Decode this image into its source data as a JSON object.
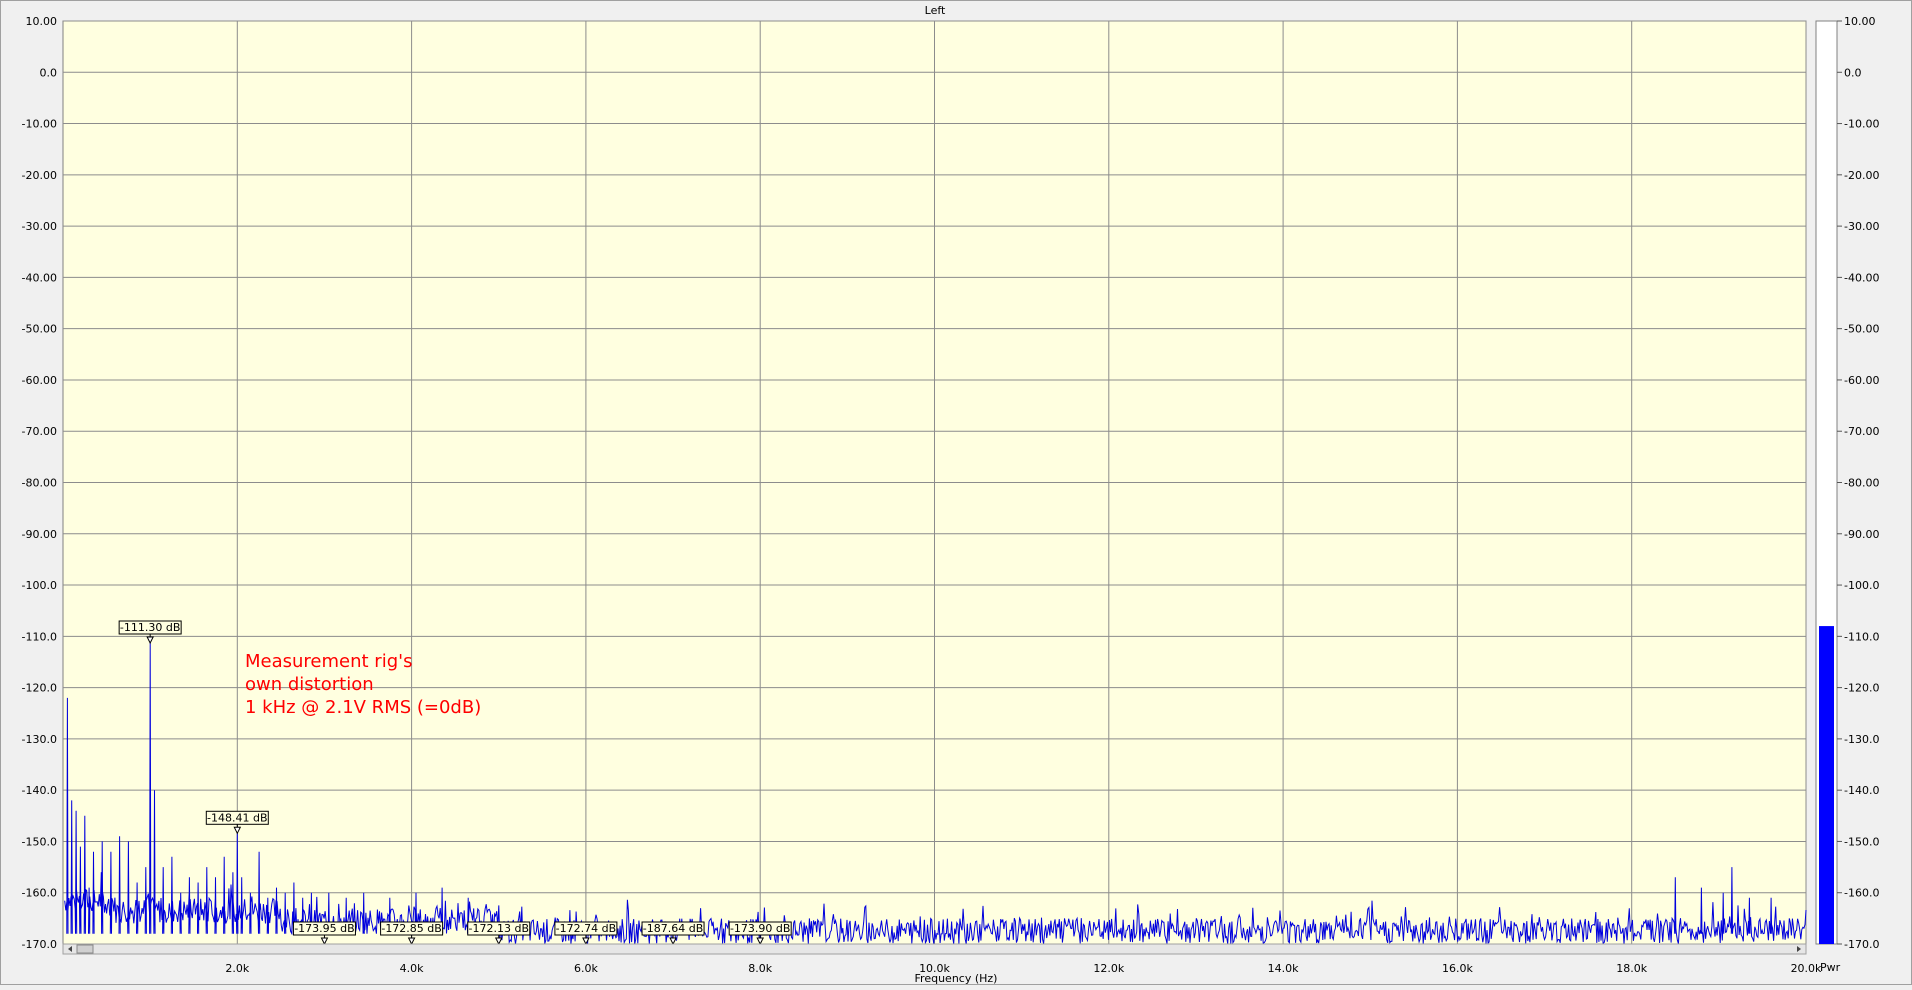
{
  "chart_data": {
    "type": "line",
    "title": "Left",
    "xlabel": "Frequency (Hz)",
    "ylabel": "",
    "xlim": [
      0,
      20000
    ],
    "ylim": [
      -170,
      10
    ],
    "grid": true,
    "y_ticks": [
      "10.00",
      "0.0",
      "-10.00",
      "-20.00",
      "-30.00",
      "-40.00",
      "-50.00",
      "-60.00",
      "-70.00",
      "-80.00",
      "-90.00",
      "-100.0",
      "-110.0",
      "-120.0",
      "-130.0",
      "-140.0",
      "-150.0",
      "-160.0",
      "-170.0"
    ],
    "y_tick_values": [
      10,
      0,
      -10,
      -20,
      -30,
      -40,
      -50,
      -60,
      -70,
      -80,
      -90,
      -100,
      -110,
      -120,
      -130,
      -140,
      -150,
      -160,
      -170
    ],
    "x_ticks": [
      "2.0k",
      "4.0k",
      "6.0k",
      "8.0k",
      "10.0k",
      "12.0k",
      "14.0k",
      "16.0k",
      "18.0k",
      "20.0k"
    ],
    "x_tick_values": [
      2000,
      4000,
      6000,
      8000,
      10000,
      12000,
      14000,
      16000,
      18000,
      20000
    ],
    "series": [
      {
        "color": "#0000dd",
        "peaks": [
          {
            "x": 50,
            "y": -122
          },
          {
            "x": 100,
            "y": -142
          },
          {
            "x": 150,
            "y": -144
          },
          {
            "x": 200,
            "y": -151
          },
          {
            "x": 250,
            "y": -145
          },
          {
            "x": 300,
            "y": -159
          },
          {
            "x": 350,
            "y": -152
          },
          {
            "x": 450,
            "y": -150
          },
          {
            "x": 550,
            "y": -152
          },
          {
            "x": 650,
            "y": -149
          },
          {
            "x": 750,
            "y": -150
          },
          {
            "x": 850,
            "y": -158
          },
          {
            "x": 950,
            "y": -155
          },
          {
            "x": 1000,
            "y": -111.3
          },
          {
            "x": 1050,
            "y": -140
          },
          {
            "x": 1150,
            "y": -155
          },
          {
            "x": 1250,
            "y": -153
          },
          {
            "x": 1350,
            "y": -160
          },
          {
            "x": 1450,
            "y": -157
          },
          {
            "x": 1550,
            "y": -158
          },
          {
            "x": 1650,
            "y": -155
          },
          {
            "x": 1750,
            "y": -157
          },
          {
            "x": 1850,
            "y": -153
          },
          {
            "x": 1950,
            "y": -156
          },
          {
            "x": 2000,
            "y": -148.41
          },
          {
            "x": 2050,
            "y": -157
          },
          {
            "x": 2150,
            "y": -160
          },
          {
            "x": 2250,
            "y": -152
          },
          {
            "x": 2350,
            "y": -161
          },
          {
            "x": 2450,
            "y": -159
          },
          {
            "x": 2550,
            "y": -160
          },
          {
            "x": 2650,
            "y": -158
          },
          {
            "x": 2750,
            "y": -161
          },
          {
            "x": 2850,
            "y": -160
          },
          {
            "x": 3050,
            "y": -160
          },
          {
            "x": 3250,
            "y": -161
          },
          {
            "x": 3450,
            "y": -160
          },
          {
            "x": 3750,
            "y": -161
          },
          {
            "x": 4050,
            "y": -160
          },
          {
            "x": 4350,
            "y": -159
          },
          {
            "x": 4650,
            "y": -161
          },
          {
            "x": 18500,
            "y": -157
          },
          {
            "x": 18800,
            "y": -159
          },
          {
            "x": 19050,
            "y": -160
          },
          {
            "x": 19150,
            "y": -155
          },
          {
            "x": 19350,
            "y": -161
          },
          {
            "x": 19600,
            "y": -161
          }
        ],
        "noise_floor": -167
      }
    ],
    "markers": [
      {
        "label": "-111.30 dB",
        "x": 1000,
        "y": -111.3
      },
      {
        "label": "-148.41 dB",
        "x": 2000,
        "y": -148.41
      },
      {
        "label": "-173.95 dB",
        "x": 3000,
        "y": -170
      },
      {
        "label": "-172.85 dB",
        "x": 4000,
        "y": -170
      },
      {
        "label": "-172.13 dB",
        "x": 5000,
        "y": -170
      },
      {
        "label": "-172.74 dB",
        "x": 6000,
        "y": -170
      },
      {
        "label": "-187.64 dB",
        "x": 7000,
        "y": -170
      },
      {
        "label": "-173.90 dB",
        "x": 8000,
        "y": -170
      }
    ],
    "annotation": {
      "lines": [
        "Measurement rig's",
        "own distortion",
        "1 kHz @ 2.1V RMS (=0dB)"
      ],
      "color": "#ff0000"
    },
    "power_meter": {
      "label": "Pwr",
      "value": -108,
      "color": "#0000ff",
      "ylim": [
        -170,
        10
      ]
    }
  },
  "colors": {
    "plot_background": "#ffffe0",
    "grid": "#8c8c8c",
    "trace": "#0000dd"
  }
}
